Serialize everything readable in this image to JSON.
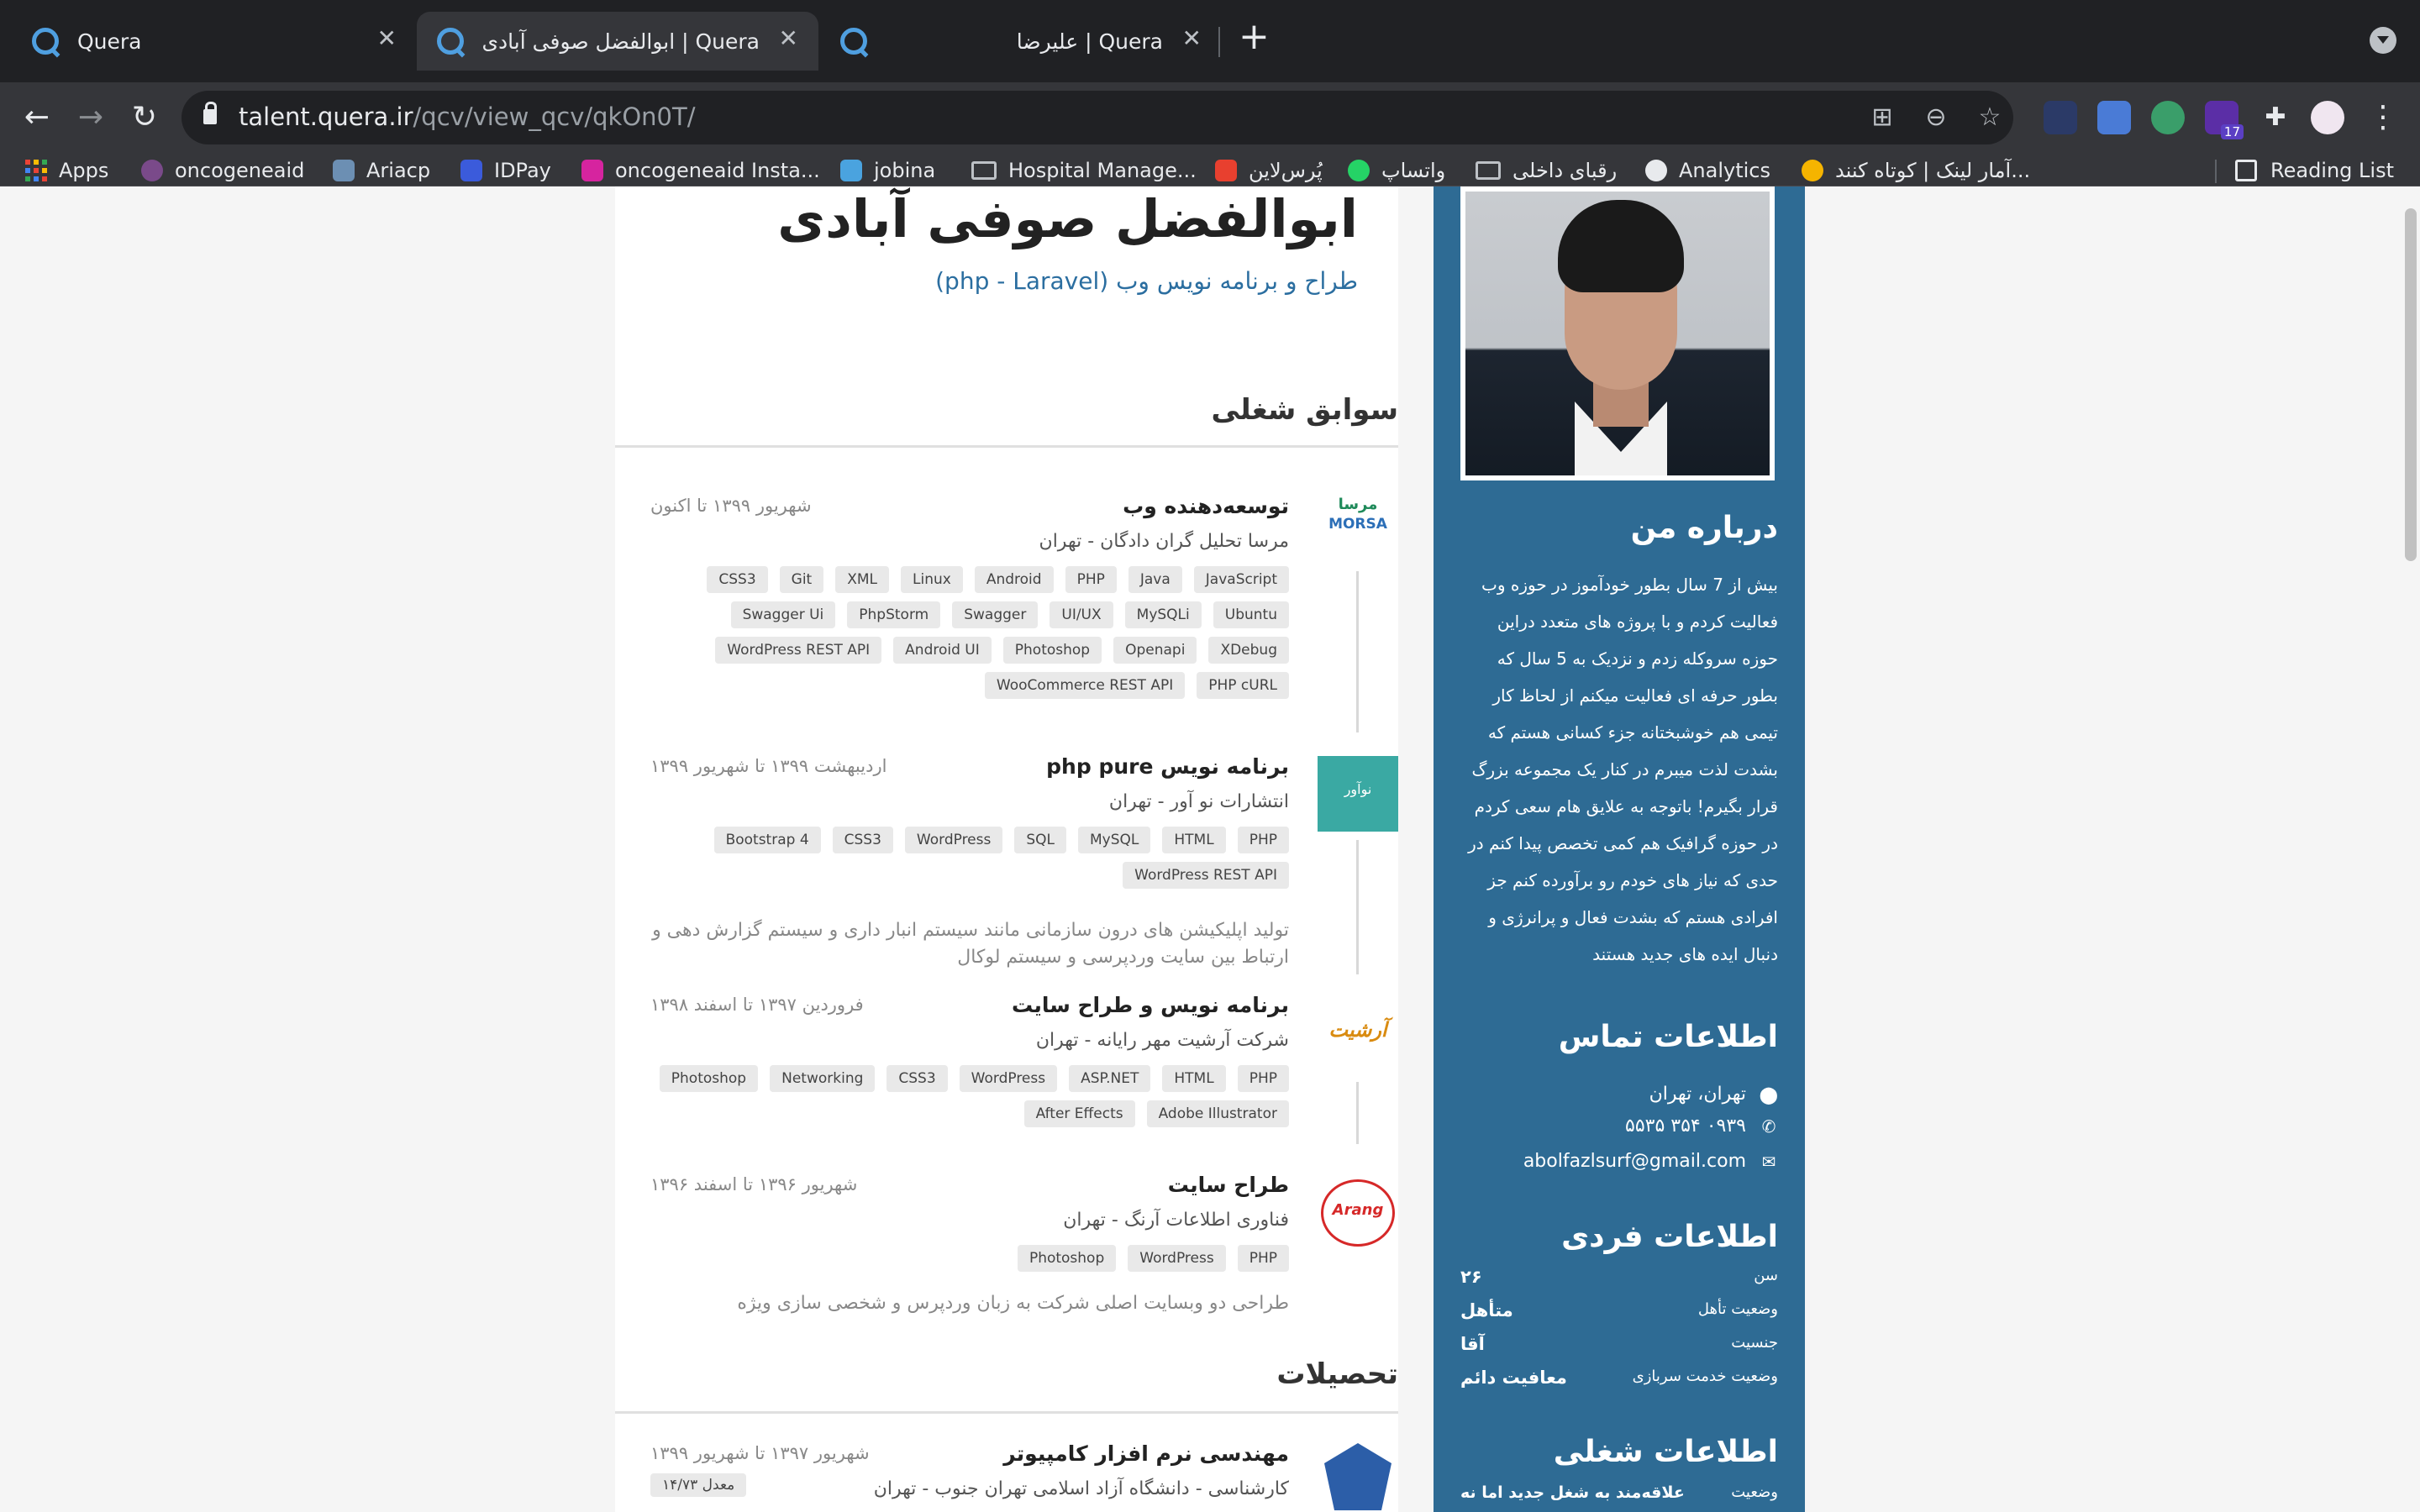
{
  "browser": {
    "tabs": [
      {
        "title": "Quera",
        "close": "✕"
      },
      {
        "title": "ابوالفضل صوفی آبادی | Quera",
        "close": "✕"
      },
      {
        "title": "علیرضا | Quera",
        "close": "✕"
      }
    ],
    "new_tab": "+",
    "url_host": "talent.quera.ir",
    "url_path": "/qcv/view_qcv/qkOn0T/",
    "extension_badge": "17",
    "bookmarks": [
      "Apps",
      "oncogeneaid",
      "Ariacp",
      "IDPay",
      "oncogeneaid Insta...",
      "jobina",
      "Hospital Manage...",
      "پُرس‌لاین",
      "واتساپ",
      "رقبای داخلی",
      "Analytics",
      "آمار لینک | کوتاه کنند..."
    ],
    "reading_list": "Reading List"
  },
  "profile": {
    "name": "ابوالفضل صوفی آبادی",
    "title": "طراح و برنامه نویس وب (php - Laravel)"
  },
  "sidebar": {
    "about_heading": "درباره من",
    "about_text": "بیش از 7 سال بطور خودآموز در حوزه وب فعالیت کردم و با پروژه های متعدد دراین حوزه سروکله زدم و نزدیک به 5 سال که بطور حرفه ای فعالیت میکنم از لحاظ کار تیمی هم خوشبختانه جزء کسانی هستم که بشدت لذت میبرم در کنار یک مجموعه بزرگ قرار بگیرم! باتوجه به علایق هام سعی کردم در حوزه گرافیک هم کمی تخصص پیدا کنم در حدی که نیاز های خودم رو برآورده کنم جز افرادی هستم که بشدت فعال و پرانرژی و دنبال ایده های جدید هستند",
    "contact_heading": "اطلاعات تماس",
    "location": "تهران، تهران",
    "phone": "۰۹۳۹ ۳۵۴ ۵۵۳۵",
    "email": "abolfazlsurf@gmail.com",
    "personal_heading": "اطلاعات فردی",
    "personal": [
      {
        "label": "سن",
        "value": "۲۶"
      },
      {
        "label": "وضعیت تأهل",
        "value": "متأهل"
      },
      {
        "label": "جنسیت",
        "value": "آقا"
      },
      {
        "label": "وضعیت خدمت سربازی",
        "value": "معافیت دائم"
      }
    ],
    "job_heading": "اطلاعات شغلی",
    "job_status_label": "وضعیت",
    "job_status_value": "علاقه‌مند به شغل جدید اما نه"
  },
  "experience_heading": "سوابق شغلی",
  "experience": [
    {
      "title": "توسعه‌دهنده وب",
      "date": "شهریور ۱۳۹۹ تا اکنون",
      "company": "مرسا تحلیل گران دادگان - تهران",
      "logo_text": "MORSA",
      "tags": [
        "JavaScript",
        "Java",
        "PHP",
        "Android",
        "Linux",
        "XML",
        "Git",
        "CSS3",
        "Ubuntu",
        "MySQLi",
        "UI/UX",
        "Swagger",
        "PhpStorm",
        "Swagger Ui",
        "XDebug",
        "Openapi",
        "Photoshop",
        "Android UI",
        "WordPress REST API",
        "PHP cURL",
        "WooCommerce REST API"
      ],
      "description": ""
    },
    {
      "title": "برنامه نویس php pure",
      "date": "اردیبهشت ۱۳۹۹ تا شهریور ۱۳۹۹",
      "company": "انتشارات نو آور - تهران",
      "logo_text": "نوآور",
      "tags": [
        "PHP",
        "HTML",
        "MySQL",
        "SQL",
        "WordPress",
        "CSS3",
        "Bootstrap 4",
        "WordPress REST API"
      ],
      "description": "تولید اپلیکیشن های درون سازمانی مانند سیستم انبار داری و سیستم گزارش دهی و ارتباط بین سایت وردپرسی و سیستم لوکال"
    },
    {
      "title": "برنامه نویس و طراح سایت",
      "date": "فروردین ۱۳۹۷ تا اسفند ۱۳۹۸",
      "company": "شرکت آرشیت مهر رایانه - تهران",
      "logo_text": "آرشیت",
      "tags": [
        "PHP",
        "HTML",
        "ASP.NET",
        "WordPress",
        "CSS3",
        "Networking",
        "Photoshop",
        "Adobe Illustrator",
        "After Effects"
      ],
      "description": ""
    },
    {
      "title": "طراح سایت",
      "date": "شهریور ۱۳۹۶ تا اسفند ۱۳۹۶",
      "company": "فناوری اطلاعات آرنگ - تهران",
      "logo_text": "Arang",
      "tags": [
        "PHP",
        "WordPress",
        "Photoshop"
      ],
      "description": "طراحی دو وبسایت اصلی شرکت به زبان وردپرس و شخصی سازی ویژه"
    }
  ],
  "education_heading": "تحصیلات",
  "education": [
    {
      "title": "مهندسی نرم افزار کامپیوتر",
      "date": "شهریور ۱۳۹۷ تا شهریور ۱۳۹۹",
      "institution": "کارشناسی - دانشگاه آزاد اسلامی تهران جنوب - تهران",
      "gpa": "معدل ۱۴/۷۳"
    }
  ],
  "colors": {
    "sidebar": "#2e6b94",
    "accent": "#2b6ea0",
    "tag_bg": "#e9e9e9"
  }
}
